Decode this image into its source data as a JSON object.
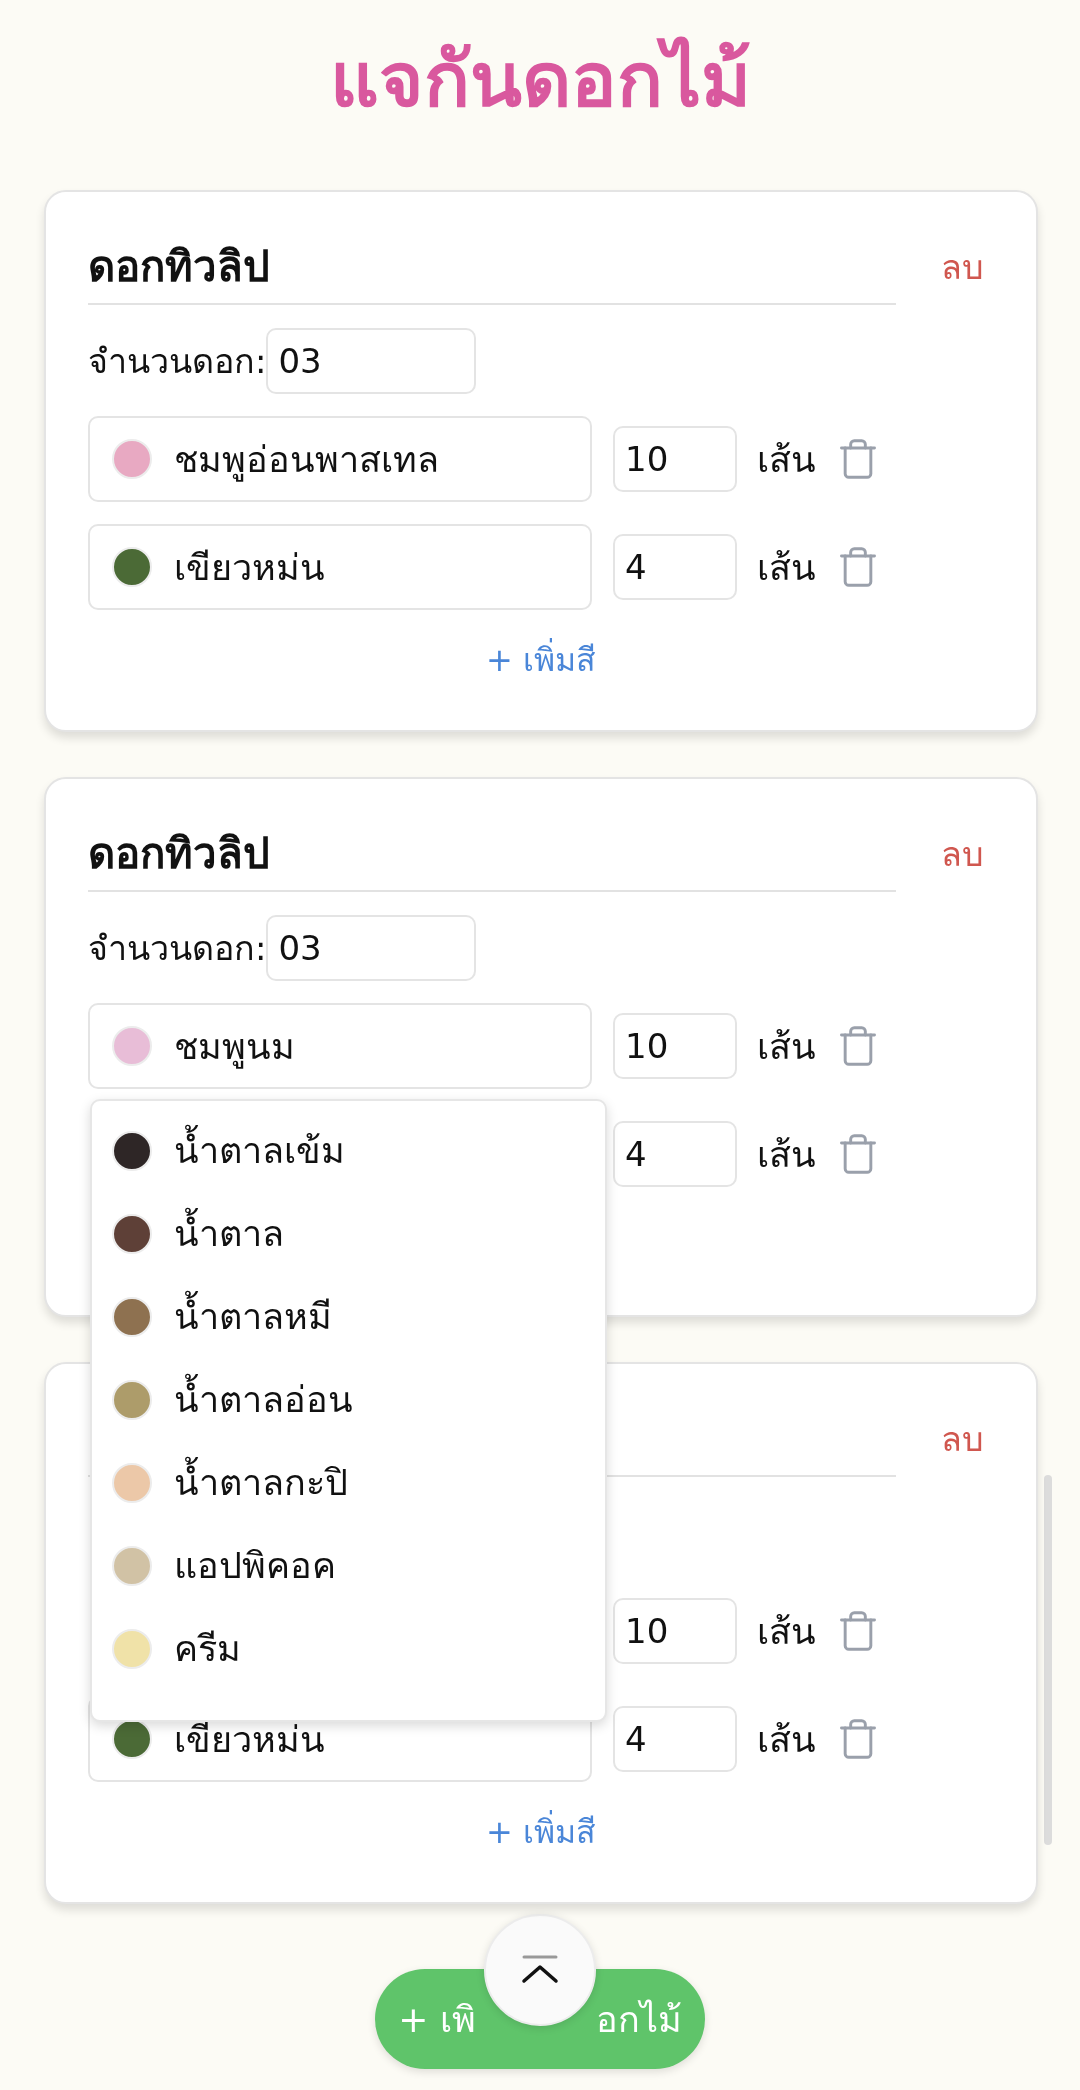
{
  "title": "แจกันดอกไม้",
  "flowers": [
    {
      "name": "ดอกทิวลิป",
      "remove": "ลบ",
      "count_label": "จำนวนดอก:",
      "count": "03",
      "colors": [
        {
          "name": "ชมพูอ่อนพาสเทล",
          "color": "#e8a9c2",
          "qty": "10",
          "unit": "เส้น"
        },
        {
          "name": "เขียวหม่น",
          "color": "#4b6a36",
          "qty": "4",
          "unit": "เส้น"
        }
      ],
      "add_color": "+ เพิ่มสี"
    },
    {
      "name": "ดอกทิวลิป",
      "remove": "ลบ",
      "count_label": "จำนวนดอก:",
      "count": "03",
      "colors": [
        {
          "name": "ชมพูนม",
          "color": "#e8bdd7",
          "qty": "10",
          "unit": "เส้น",
          "menu": [
            {
              "name": "น้ำตาลเข้ม",
              "color": "#2e2626"
            },
            {
              "name": "น้ำตาล",
              "color": "#5e4037"
            },
            {
              "name": "น้ำตาลหมี",
              "color": "#8e7150"
            },
            {
              "name": "น้ำตาลอ่อน",
              "color": "#ad9c6a"
            },
            {
              "name": "น้ำตาลกะปิ",
              "color": "#ecc8a8"
            },
            {
              "name": "แอปพิคอค",
              "color": "#d1c2a5"
            },
            {
              "name": "ครีม",
              "color": "#f0e2a8"
            }
          ]
        },
        {
          "qty": "4",
          "unit": "เส้น"
        }
      ]
    },
    {
      "remove": "ลบ",
      "colors": [
        {
          "qty": "10",
          "unit": "เส้น"
        },
        {
          "name": "เขียวหม่น",
          "color": "#4b6a36",
          "qty": "4",
          "unit": "เส้น"
        }
      ],
      "add_color": "+ เพิ่มสี"
    }
  ],
  "add_flower": [
    "+ เพิ",
    "อกไม้"
  ]
}
